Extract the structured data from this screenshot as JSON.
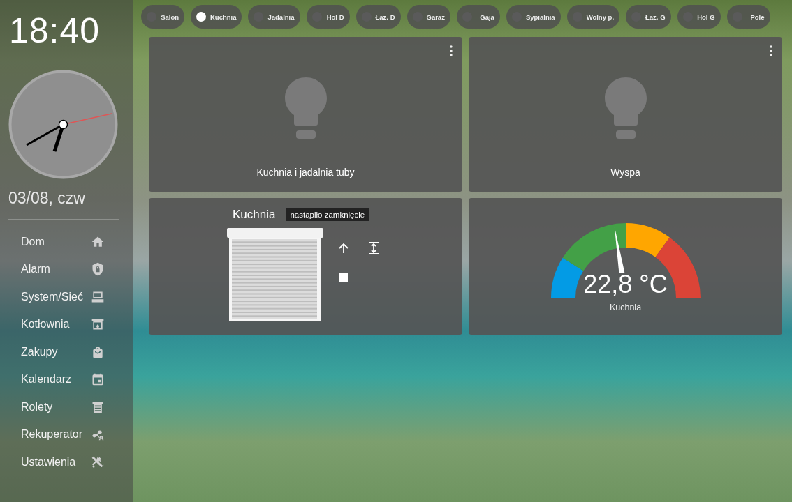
{
  "sidebar": {
    "time": "18:40",
    "date": "03/08, czw",
    "items": [
      {
        "label": "Dom"
      },
      {
        "label": "Alarm"
      },
      {
        "label": "System/Sieć"
      },
      {
        "label": "Kotłownia"
      },
      {
        "label": "Zakupy"
      },
      {
        "label": "Kalendarz"
      },
      {
        "label": "Rolety"
      },
      {
        "label": "Rekuperator"
      },
      {
        "label": "Ustawienia"
      }
    ]
  },
  "rooms": [
    {
      "label": "Salon",
      "on": false
    },
    {
      "label": "Kuchnia",
      "on": true
    },
    {
      "label": "Jadalnia",
      "on": false
    },
    {
      "label": "Hol D",
      "on": false
    },
    {
      "label": "Łaz. D",
      "on": false
    },
    {
      "label": "Garaż",
      "on": false
    },
    {
      "label": "Gaja",
      "on": false
    },
    {
      "label": "Sypialnia",
      "on": false
    },
    {
      "label": "Wolny p.",
      "on": false
    },
    {
      "label": "Łaz. G",
      "on": false
    },
    {
      "label": "Hol G",
      "on": false
    },
    {
      "label": "Pole",
      "on": false
    }
  ],
  "cards": [
    {
      "kind": "light",
      "name": "Kuchnia i jadalnia tuby",
      "on": false
    },
    {
      "kind": "light",
      "name": "Wyspa",
      "on": false
    },
    {
      "kind": "cover",
      "name": "Kuchnia",
      "status": "nastąpiło zamknięcie"
    },
    {
      "kind": "gauge",
      "reading": "22,8 °C",
      "name": "Kuchnia",
      "level": 0.45
    }
  ]
}
